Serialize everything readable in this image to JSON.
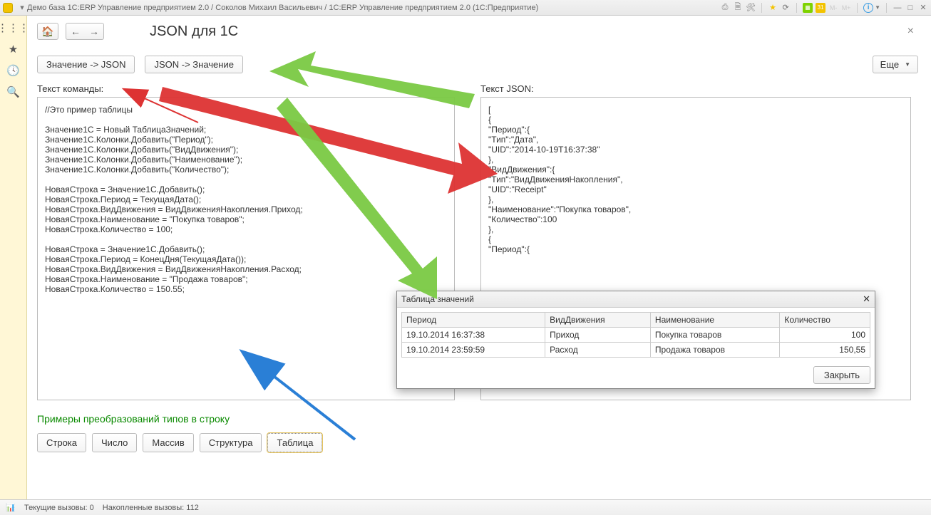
{
  "title_bar": {
    "text": "Демо база 1С:ERP Управление предприятием 2.0 / Соколов Михаил Васильевич / 1С:ERP Управление предприятием 2.0  (1С:Предприятие)"
  },
  "page": {
    "title": "JSON для 1С"
  },
  "commands": {
    "value_to_json": "Значение -> JSON",
    "json_to_value": "JSON -> Значение",
    "more": "Еще"
  },
  "labels": {
    "command_text": "Текст команды:",
    "json_text": "Текст JSON:",
    "examples": "Примеры преобразований типов в строку"
  },
  "code_left": "//Это пример таблицы\n\nЗначение1С = Новый ТаблицаЗначений;\nЗначение1С.Колонки.Добавить(\"Период\");\nЗначение1С.Колонки.Добавить(\"ВидДвижения\");\nЗначение1С.Колонки.Добавить(\"Наименование\");\nЗначение1С.Колонки.Добавить(\"Количество\");\n\nНоваяСтрока = Значение1С.Добавить();\nНоваяСтрока.Период = ТекущаяДата();\nНоваяСтрока.ВидДвижения = ВидДвиженияНакопления.Приход;\nНоваяСтрока.Наименование = \"Покупка товаров\";\nНоваяСтрока.Количество = 100;\n\nНоваяСтрока = Значение1С.Добавить();\nНоваяСтрока.Период = КонецДня(ТекущаяДата());\nНоваяСтрока.ВидДвижения = ВидДвиженияНакопления.Расход;\nНоваяСтрока.Наименование = \"Продажа товаров\";\nНоваяСтрока.Количество = 150.55;",
  "code_right": "[\n{\n\"Период\":{\n\"Тип\":\"Дата\",\n\"UID\":\"2014-10-19T16:37:38\"\n},\n\"ВидДвижения\":{\n\"Тип\":\"ВидДвиженияНакопления\",\n\"UID\":\"Receipt\"\n},\n\"Наименование\":\"Покупка товаров\",\n\"Количество\":100\n},\n{\n\"Период\":{\n\n\n\n\n\n\n\n\n\n\n]",
  "example_buttons": {
    "string": "Строка",
    "number": "Число",
    "array": "Массив",
    "struct": "Структура",
    "table": "Таблица"
  },
  "popup": {
    "title": "Таблица значений",
    "columns": {
      "period": "Период",
      "kind": "ВидДвижения",
      "name": "Наименование",
      "qty": "Количество"
    },
    "rows": [
      {
        "period": "19.10.2014 16:37:38",
        "kind": "Приход",
        "name": "Покупка товаров",
        "qty": "100"
      },
      {
        "period": "19.10.2014 23:59:59",
        "kind": "Расход",
        "name": "Продажа товаров",
        "qty": "150,55"
      }
    ],
    "close": "Закрыть"
  },
  "status": {
    "current_calls": "Текущие вызовы: 0",
    "accumulated_calls": "Накопленные вызовы: 112"
  }
}
